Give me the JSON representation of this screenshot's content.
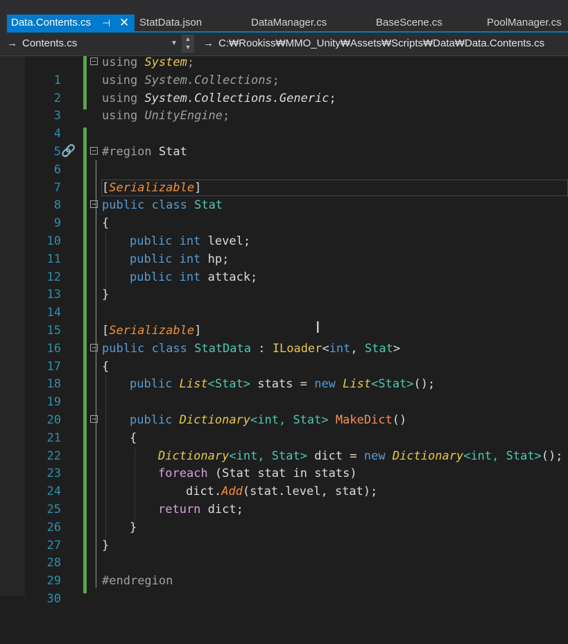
{
  "tabs": [
    {
      "label": "Data.Contents.cs",
      "active": true,
      "pin": "⊣",
      "close": "✕"
    },
    {
      "label": "StatData.json"
    },
    {
      "label": "DataManager.cs"
    },
    {
      "label": "BaseScene.cs"
    },
    {
      "label": "PoolManager.cs"
    }
  ],
  "nav": {
    "arrow_icon": "→",
    "member": "Contents.cs",
    "path": "C:₩Rookiss₩MMO_Unity₩Assets₩Scripts₩Data₩Data.Contents.cs"
  },
  "line_numbers": [
    "1",
    "2",
    "3",
    "4",
    "5",
    "6",
    "7",
    "8",
    "9",
    "10",
    "11",
    "12",
    "13",
    "14",
    "15",
    "16",
    "17",
    "18",
    "19",
    "20",
    "21",
    "22",
    "23",
    "24",
    "25",
    "26",
    "27",
    "28",
    "29",
    "30"
  ],
  "code": {
    "l1": {
      "kw": "using",
      "ns": "System",
      "end": ";"
    },
    "l2": {
      "kw": "using",
      "ns": "System.Collections",
      "end": ";"
    },
    "l3": {
      "kw": "using",
      "ns": "System.Collections.Generic",
      "end": ";"
    },
    "l4": {
      "kw": "using",
      "ns": "UnityEngine",
      "end": ";"
    },
    "l6": {
      "directive": "#region",
      "name": "Stat"
    },
    "l8": {
      "open": "[",
      "attr": "Serializable",
      "close": "]"
    },
    "l9": {
      "kw1": "public",
      "kw2": "class",
      "name": "Stat"
    },
    "l10": {
      "text": "{"
    },
    "l11": {
      "kw1": "public",
      "kw2": "int",
      "name": "level;"
    },
    "l12": {
      "kw1": "public",
      "kw2": "int",
      "name": "hp;"
    },
    "l13": {
      "kw1": "public",
      "kw2": "int",
      "name": "attack;"
    },
    "l14": {
      "text": "}"
    },
    "l16": {
      "open": "[",
      "attr": "Serializable",
      "close": "]"
    },
    "l17": {
      "kw1": "public",
      "kw2": "class",
      "name": "StatData",
      "colon": ":",
      "iface": "ILoader",
      "lt": "<",
      "t1": "int",
      ",": ",",
      "t2": "Stat",
      "gt": ">"
    },
    "l18": {
      "text": "{"
    },
    "l19": {
      "kw1": "public",
      "list": "List",
      "g": "<Stat>",
      "rest": "stats =",
      "kwnew": "new",
      "list2": "List",
      "g2": "<Stat>",
      "end": "();"
    },
    "l21": {
      "kw1": "public",
      "dict": "Dictionary",
      "g": "<int, Stat>",
      "method": "MakeDict",
      "end": "()"
    },
    "l22": {
      "text": "{"
    },
    "l23": {
      "dict": "Dictionary",
      "g": "<int, Stat>",
      "rest": "dict =",
      "kwnew": "new",
      "dict2": "Dictionary",
      "g2": "<int, Stat>",
      "end": "();"
    },
    "l24": {
      "kw": "foreach",
      "rest": "(Stat stat in stats)"
    },
    "l25": {
      "obj": "dict.",
      "method": "Add",
      "rest": "(stat.level, stat);"
    },
    "l26": {
      "kw": "return",
      "rest": "dict;"
    },
    "l27": {
      "text": "}"
    },
    "l28": {
      "text": "}"
    },
    "l30": {
      "directive": "#endregion"
    }
  },
  "colors": {
    "accent": "#007acc",
    "line_number": "#2b91af",
    "keyword": "#569cd6",
    "type": "#4ec9b0",
    "change_bar": "#57a64a"
  }
}
